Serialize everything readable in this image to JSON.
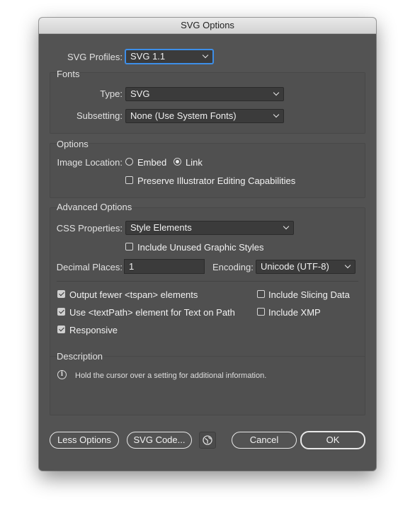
{
  "window": {
    "title": "SVG Options"
  },
  "profiles": {
    "label": "SVG Profiles:",
    "value": "SVG 1.1"
  },
  "fonts": {
    "title": "Fonts",
    "type_label": "Type:",
    "type_value": "SVG",
    "subsetting_label": "Subsetting:",
    "subsetting_value": "None (Use System Fonts)"
  },
  "options": {
    "title": "Options",
    "image_location_label": "Image Location:",
    "embed_label": "Embed",
    "embed_selected": false,
    "link_label": "Link",
    "link_selected": true,
    "preserve_label": "Preserve Illustrator Editing Capabilities",
    "preserve_checked": false
  },
  "advanced": {
    "title": "Advanced Options",
    "css_label": "CSS Properties:",
    "css_value": "Style Elements",
    "unused_styles_label": "Include Unused Graphic Styles",
    "unused_styles_checked": false,
    "decimal_label": "Decimal Places:",
    "decimal_value": "1",
    "encoding_label": "Encoding:",
    "encoding_value": "Unicode (UTF-8)",
    "checks": {
      "fewer_tspan": {
        "label": "Output fewer <tspan> elements",
        "checked": true
      },
      "textpath": {
        "label": "Use <textPath> element for Text on Path",
        "checked": true
      },
      "responsive": {
        "label": "Responsive",
        "checked": true
      },
      "slicing": {
        "label": "Include Slicing Data",
        "checked": false
      },
      "xmp": {
        "label": "Include XMP",
        "checked": false
      }
    }
  },
  "description": {
    "title": "Description",
    "text": "Hold the cursor over a setting for additional information."
  },
  "buttons": {
    "less_options": "Less Options",
    "svg_code": "SVG Code...",
    "cancel": "Cancel",
    "ok": "OK"
  },
  "icons": {
    "web": "globe-icon",
    "info": "info-icon"
  }
}
